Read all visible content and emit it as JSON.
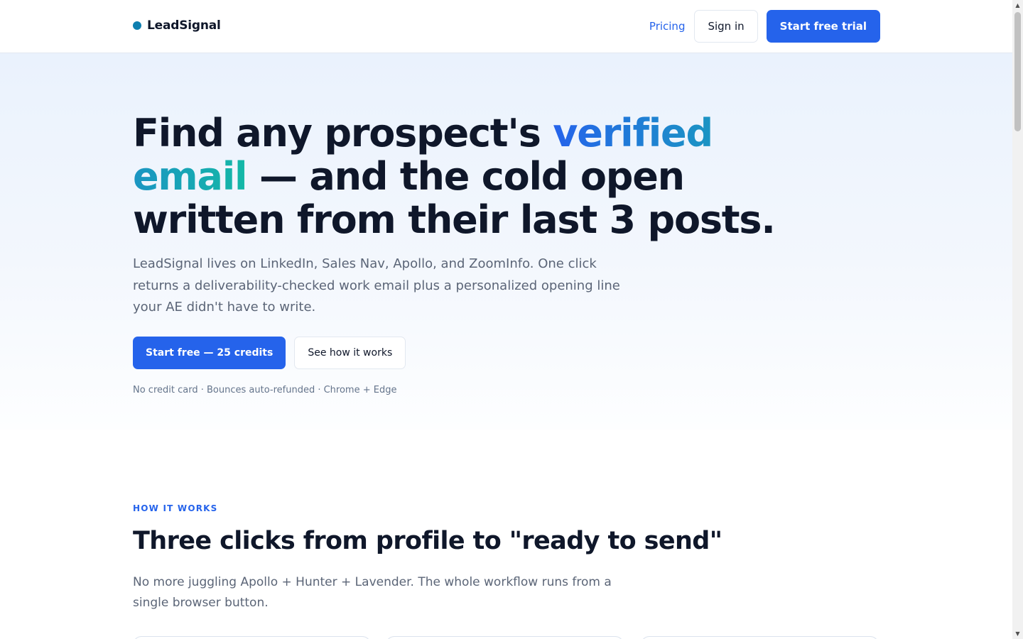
{
  "header": {
    "brand": "LeadSignal",
    "nav_pricing": "Pricing",
    "sign_in": "Sign in",
    "start_trial": "Start free trial"
  },
  "hero": {
    "title_part1": "Find any prospect's ",
    "title_highlight": "verified email",
    "title_part2": " — and the cold open written from their last 3 posts.",
    "subtitle": "LeadSignal lives on LinkedIn, Sales Nav, Apollo, and ZoomInfo. One click returns a deliverability-checked work email plus a personalized opening line your AE didn't have to write.",
    "cta_primary": "Start free — 25 credits",
    "cta_secondary": "See how it works",
    "note": "No credit card · Bounces auto-refunded · Chrome + Edge"
  },
  "how_it_works": {
    "eyebrow": "HOW IT WORKS",
    "title": "Three clicks from profile to \"ready to send\"",
    "subtitle": "No more juggling Apollo + Hunter + Lavender. The whole workflow runs from a single browser button."
  },
  "colors": {
    "accent": "#2563eb",
    "gradient_end": "#14b8a6",
    "brand_dot": "#0e7fb0"
  },
  "icons": {
    "scroll_up": "▲",
    "scroll_down": "▼"
  }
}
